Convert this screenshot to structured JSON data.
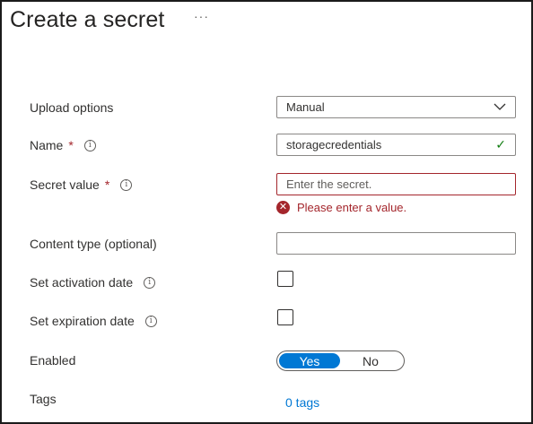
{
  "header": {
    "title": "Create a secret",
    "more": "···"
  },
  "form": {
    "upload_options": {
      "label": "Upload options",
      "value": "Manual"
    },
    "name": {
      "label": "Name",
      "required_mark": "*",
      "info": "i",
      "value": "storagecredentials",
      "valid_mark": "✓"
    },
    "secret_value": {
      "label": "Secret value",
      "required_mark": "*",
      "info": "i",
      "placeholder": "Enter the secret.",
      "error_icon": "✕",
      "error": "Please enter a value."
    },
    "content_type": {
      "label": "Content type (optional)",
      "value": ""
    },
    "activation_date": {
      "label": "Set activation date",
      "info": "i"
    },
    "expiration_date": {
      "label": "Set expiration date",
      "info": "i"
    },
    "enabled": {
      "label": "Enabled",
      "yes": "Yes",
      "no": "No",
      "selected": "Yes"
    },
    "tags": {
      "label": "Tags",
      "link": "0 tags"
    }
  },
  "colors": {
    "accent": "#0078d4",
    "error": "#a4262c",
    "valid": "#107c10"
  }
}
